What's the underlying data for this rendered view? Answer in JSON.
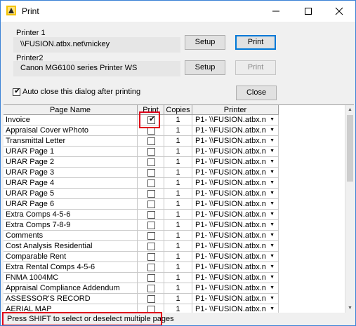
{
  "window": {
    "title": "Print"
  },
  "printer1": {
    "label": "Printer 1",
    "name": "\\\\FUSION.atbx.net\\mickey",
    "setup_label": "Setup",
    "print_label": "Print"
  },
  "printer2": {
    "label": "Printer2",
    "name": "Canon MG6100 series Printer WS",
    "setup_label": "Setup",
    "print_label": "Print"
  },
  "options": {
    "auto_close_label": "Auto close this dialog after printing",
    "auto_close_checked": true,
    "close_label": "Close"
  },
  "table": {
    "headers": {
      "page_name": "Page Name",
      "print": "Print",
      "copies": "Copies",
      "printer": "Printer"
    },
    "rows": [
      {
        "name": "Invoice",
        "print": true,
        "copies": "1",
        "printer": "P1- \\\\FUSION.atbx.n"
      },
      {
        "name": "Appraisal Cover wPhoto",
        "print": false,
        "copies": "1",
        "printer": "P1- \\\\FUSION.atbx.n"
      },
      {
        "name": "Transmittal Letter",
        "print": false,
        "copies": "1",
        "printer": "P1- \\\\FUSION.atbx.n"
      },
      {
        "name": "URAR Page 1",
        "print": false,
        "copies": "1",
        "printer": "P1- \\\\FUSION.atbx.n"
      },
      {
        "name": "URAR Page 2",
        "print": false,
        "copies": "1",
        "printer": "P1- \\\\FUSION.atbx.n"
      },
      {
        "name": "URAR Page 3",
        "print": false,
        "copies": "1",
        "printer": "P1- \\\\FUSION.atbx.n"
      },
      {
        "name": "URAR Page 4",
        "print": false,
        "copies": "1",
        "printer": "P1- \\\\FUSION.atbx.n"
      },
      {
        "name": "URAR Page 5",
        "print": false,
        "copies": "1",
        "printer": "P1- \\\\FUSION.atbx.n"
      },
      {
        "name": "URAR Page 6",
        "print": false,
        "copies": "1",
        "printer": "P1- \\\\FUSION.atbx.n"
      },
      {
        "name": "Extra Comps 4-5-6",
        "print": false,
        "copies": "1",
        "printer": "P1- \\\\FUSION.atbx.n"
      },
      {
        "name": "Extra Comps 7-8-9",
        "print": false,
        "copies": "1",
        "printer": "P1- \\\\FUSION.atbx.n"
      },
      {
        "name": "Comments",
        "print": false,
        "copies": "1",
        "printer": "P1- \\\\FUSION.atbx.n"
      },
      {
        "name": "Cost Analysis Residential",
        "print": false,
        "copies": "1",
        "printer": "P1- \\\\FUSION.atbx.n"
      },
      {
        "name": "Comparable Rent",
        "print": false,
        "copies": "1",
        "printer": "P1- \\\\FUSION.atbx.n"
      },
      {
        "name": "Extra Rental Comps 4-5-6",
        "print": false,
        "copies": "1",
        "printer": "P1- \\\\FUSION.atbx.n"
      },
      {
        "name": "FNMA 1004MC",
        "print": false,
        "copies": "1",
        "printer": "P1- \\\\FUSION.atbx.n"
      },
      {
        "name": "Appraisal Compliance Addendum",
        "print": false,
        "copies": "1",
        "printer": "P1- \\\\FUSION.atbx.n"
      },
      {
        "name": "ASSESSOR'S RECORD",
        "print": false,
        "copies": "1",
        "printer": "P1- \\\\FUSION.atbx.n"
      },
      {
        "name": "AERIAL MAP",
        "print": false,
        "copies": "1",
        "printer": "P1- \\\\FUSION.atbx.n"
      }
    ]
  },
  "status": {
    "text": "Press SHIFT to select or deselect multiple pages"
  },
  "icons": {
    "dropdown": "chevron-down-icon",
    "app": "app-icon",
    "minimize": "minimize-icon",
    "maximize": "maximize-icon",
    "close": "close-icon",
    "scroll_up": "scroll-up-icon",
    "scroll_down": "scroll-down-icon"
  },
  "colors": {
    "highlight": "#e0001b",
    "focus": "#0078d7",
    "window_border": "#3b82d6"
  }
}
